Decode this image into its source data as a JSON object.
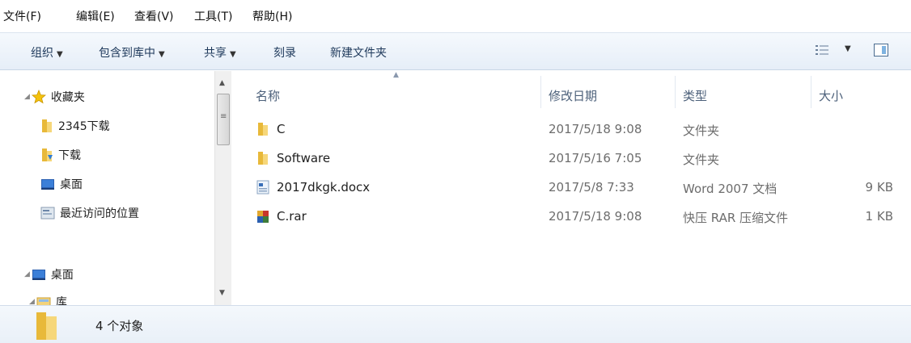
{
  "menu": [
    "文件(F)",
    "编辑(E)",
    "查看(V)",
    "工具(T)",
    "帮助(H)"
  ],
  "toolbar": {
    "organize": "组织",
    "include_library": "包含到库中",
    "share": "共享",
    "burn": "刻录",
    "new_folder": "新建文件夹"
  },
  "nav": {
    "favorites": "收藏夹",
    "fav_items": [
      "2345下载",
      "下载",
      "桌面",
      "最近访问的位置"
    ],
    "desktop": "桌面",
    "library": "库"
  },
  "columns": {
    "name": "名称",
    "date": "修改日期",
    "type": "类型",
    "size": "大小"
  },
  "files": [
    {
      "name": "C",
      "date": "2017/5/18 9:08",
      "type": "文件夹",
      "size": "",
      "icon": "folder-icon"
    },
    {
      "name": "Software",
      "date": "2017/5/16 7:05",
      "type": "文件夹",
      "size": "",
      "icon": "folder-icon"
    },
    {
      "name": "2017dkgk.docx",
      "date": "2017/5/8 7:33",
      "type": "Word 2007 文档",
      "size": "9 KB",
      "icon": "word-document-icon"
    },
    {
      "name": "C.rar",
      "date": "2017/5/18 9:08",
      "type": "快压 RAR 压缩文件",
      "size": "1 KB",
      "icon": "rar-archive-icon"
    }
  ],
  "status": {
    "count": "4 个对象"
  }
}
